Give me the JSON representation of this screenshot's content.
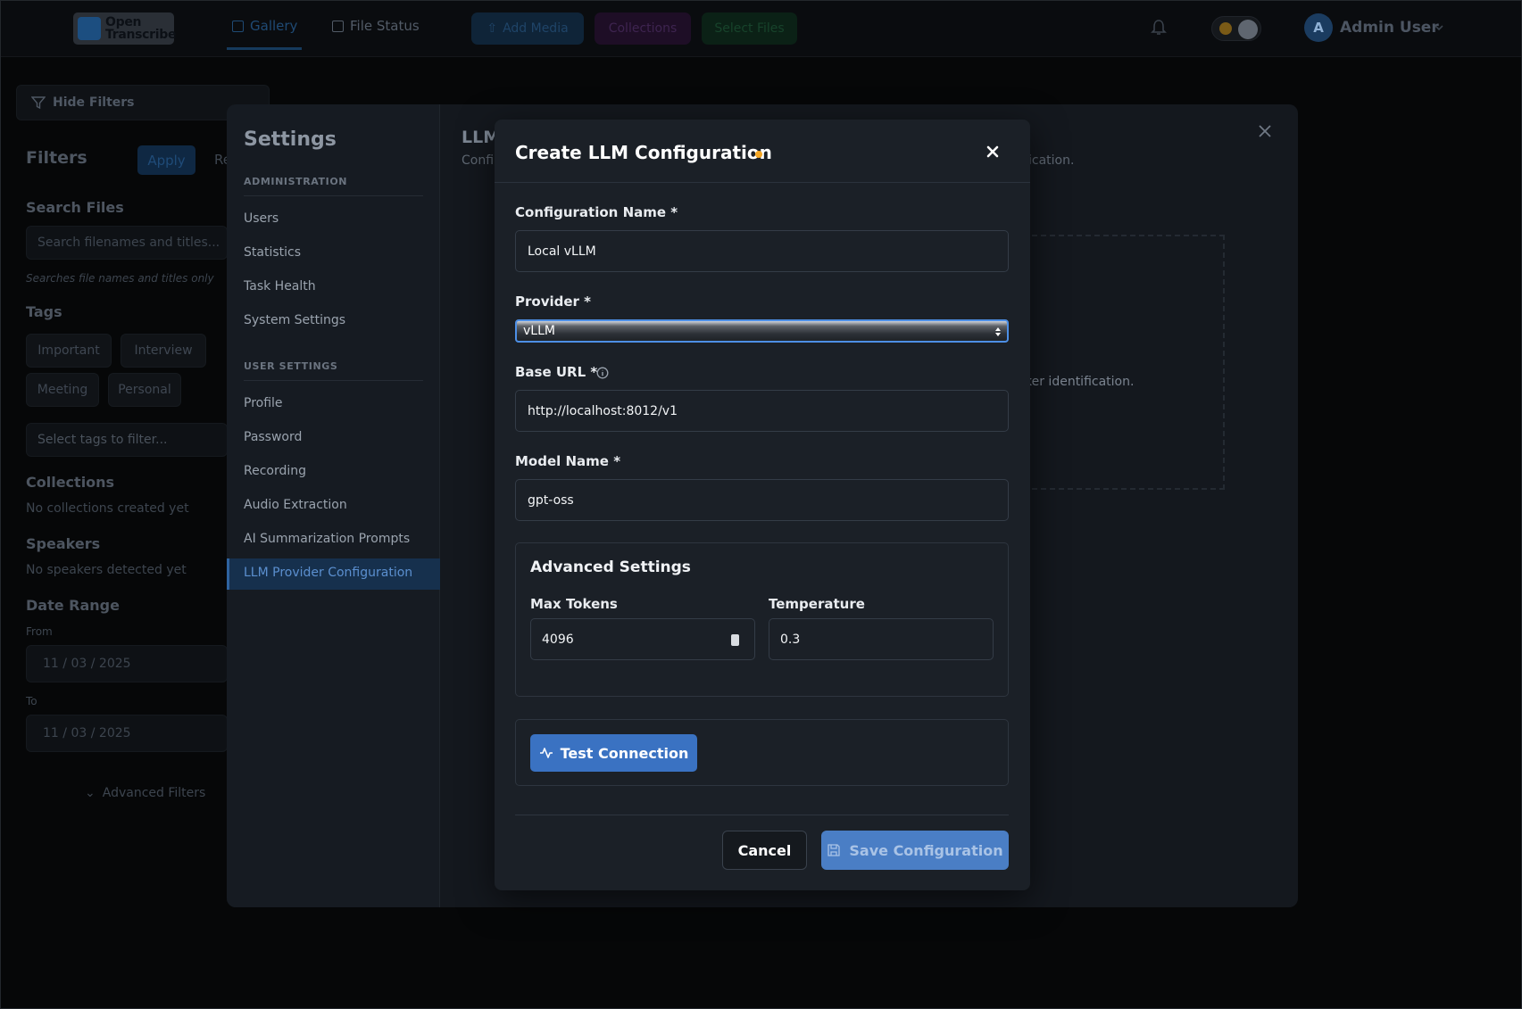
{
  "app": {
    "logo_text_1": "Open",
    "logo_text_2": "Transcribe",
    "nav": {
      "gallery": "Gallery",
      "file_status": "File Status"
    },
    "actions": {
      "add_media": "Add Media",
      "collections": "Collections",
      "select_files": "Select Files"
    },
    "user": {
      "initial": "A",
      "name": "Admin User"
    }
  },
  "filters": {
    "hide_label": "Hide Filters",
    "title": "Filters",
    "apply": "Apply",
    "reset_partial": "Re",
    "search_heading": "Search Files",
    "search_placeholder": "Search filenames and titles...",
    "search_hint": "Searches file names and titles only",
    "tags_heading": "Tags",
    "tags": [
      "Important",
      "Interview",
      "Meeting",
      "Personal"
    ],
    "tags_placeholder": "Select tags to filter...",
    "collections_heading": "Collections",
    "collections_empty": "No collections created yet",
    "speakers_heading": "Speakers",
    "speakers_empty": "No speakers detected yet",
    "date_heading": "Date Range",
    "from_label": "From",
    "from_value": {
      "m": "11",
      "d": "03",
      "y": "2025"
    },
    "to_label": "To",
    "to_value": {
      "m": "11",
      "d": "03",
      "y": "2025"
    },
    "advanced": "Advanced Filters"
  },
  "settings": {
    "title": "Settings",
    "admin_heading": "ADMINISTRATION",
    "admin_items": [
      "Users",
      "Statistics",
      "Task Health",
      "System Settings"
    ],
    "user_heading": "USER SETTINGS",
    "user_items": [
      "Profile",
      "Password",
      "Recording",
      "Audio Extraction",
      "AI Summarization Prompts",
      "LLM Provider Configuration"
    ],
    "content_title_partial": "LLM",
    "content_sub_partial": "Confi",
    "content_sub_end": "ication.",
    "content_speaker_text": "ker identification."
  },
  "dialog": {
    "title": "Create LLM Configuration",
    "config_name_label": "Configuration Name *",
    "config_name_value": "Local vLLM",
    "provider_label": "Provider *",
    "provider_value": "vLLM",
    "base_url_label": "Base URL *",
    "base_url_value": "http://localhost:8012/v1",
    "model_label": "Model Name *",
    "model_value": "gpt-oss",
    "advanced_title": "Advanced Settings",
    "max_tokens_label": "Max Tokens",
    "max_tokens_value": "4096",
    "temperature_label": "Temperature",
    "temperature_value": "0.3",
    "test_button": "Test Connection",
    "cancel_button": "Cancel",
    "save_button": "Save Configuration"
  },
  "colors": {
    "accent": "#3a72c2",
    "unsaved_dot": "#f5a623",
    "backdrop": "#060708"
  }
}
